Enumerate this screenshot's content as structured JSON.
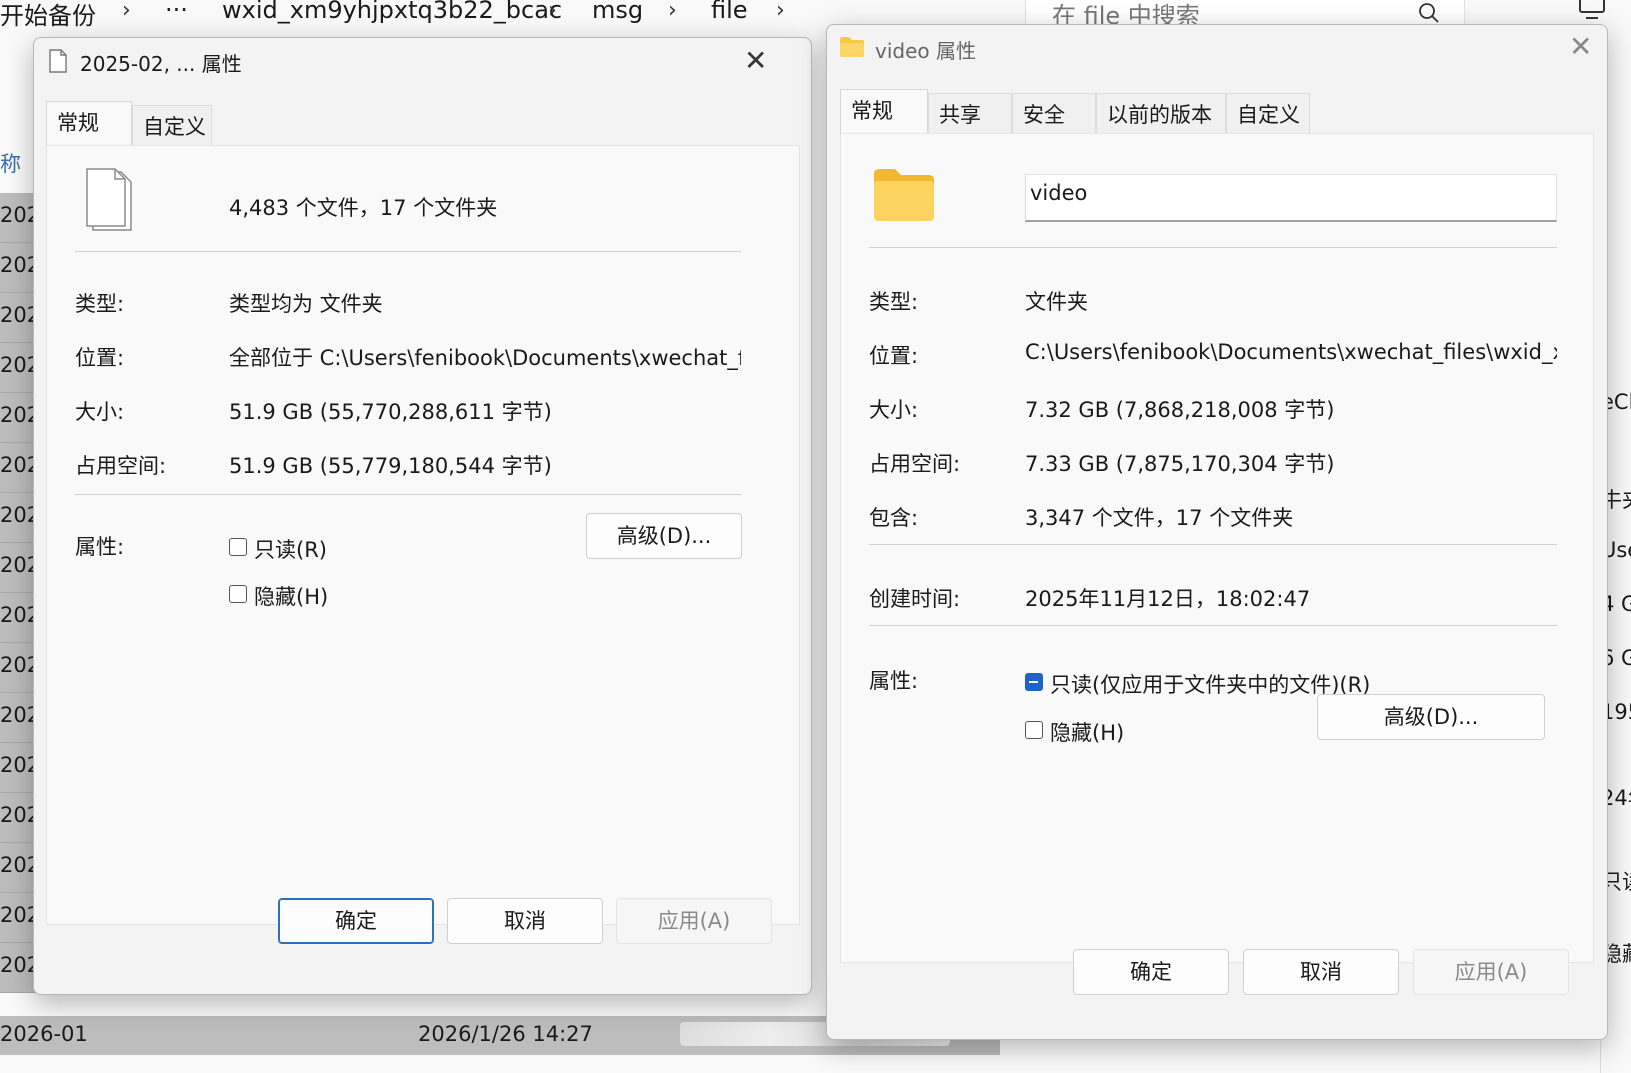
{
  "explorer": {
    "breadcrumbs": [
      "开始备份",
      "···",
      "wxid_xm9yhjpxtq3b22_bcac",
      "msg",
      "file"
    ],
    "search_placeholder": "在 file 中搜索",
    "column_name": "称",
    "row_prefix": "202",
    "bottom_row": {
      "name": "2026-01",
      "date": "2026/1/26 14:27"
    },
    "right_snippets": [
      "eCh",
      "牛夹",
      "Use",
      "4 G",
      "6 G",
      "195",
      "24年",
      "只读",
      "隐藏"
    ]
  },
  "dialog_left": {
    "title": "2025-02, ... 属性",
    "tabs": [
      "常规",
      "自定义"
    ],
    "summary": "4,483 个文件，17 个文件夹",
    "rows": [
      {
        "label": "类型:",
        "value": "类型均为 文件夹"
      },
      {
        "label": "位置:",
        "value": "全部位于 C:\\Users\\fenibook\\Documents\\xwechat_files"
      },
      {
        "label": "大小:",
        "value": "51.9 GB (55,770,288,611 字节)"
      },
      {
        "label": "占用空间:",
        "value": "51.9 GB (55,779,180,544 字节)"
      }
    ],
    "attr_label": "属性:",
    "readonly_label": "只读(R)",
    "hidden_label": "隐藏(H)",
    "advanced_button": "高级(D)...",
    "ok_button": "确定",
    "cancel_button": "取消",
    "apply_button": "应用(A)"
  },
  "dialog_right": {
    "title": "video 属性",
    "tabs": [
      "常规",
      "共享",
      "安全",
      "以前的版本",
      "自定义"
    ],
    "name_value": "video",
    "rows": [
      {
        "label": "类型:",
        "value": "文件夹"
      },
      {
        "label": "位置:",
        "value": "C:\\Users\\fenibook\\Documents\\xwechat_files\\wxid_xm"
      },
      {
        "label": "大小:",
        "value": "7.32 GB (7,868,218,008 字节)"
      },
      {
        "label": "占用空间:",
        "value": "7.33 GB (7,875,170,304 字节)"
      },
      {
        "label": "包含:",
        "value": "3,347 个文件，17 个文件夹"
      }
    ],
    "created_label": "创建时间:",
    "created_value": "2025年11月12日，18:02:47",
    "attr_label": "属性:",
    "readonly_label": "只读(仅应用于文件夹中的文件)(R)",
    "hidden_label": "隐藏(H)",
    "advanced_button": "高级(D)...",
    "ok_button": "确定",
    "cancel_button": "取消",
    "apply_button": "应用(A)"
  }
}
